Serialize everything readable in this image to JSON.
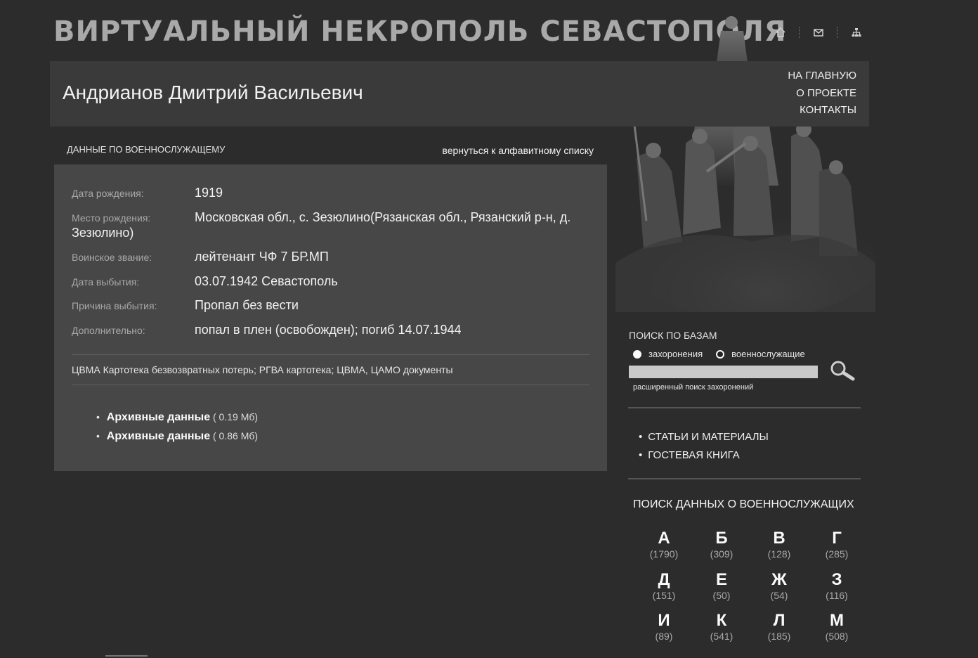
{
  "site": {
    "title": "ВИРТУАЛЬНЫЙ НЕКРОПОЛЬ СЕВАСТОПОЛЯ"
  },
  "top_icons": [
    "home-icon",
    "mail-icon",
    "sitemap-icon"
  ],
  "nav": {
    "home": "НА ГЛАВНУЮ",
    "about": "О ПРОЕКТЕ",
    "contacts": "КОНТАКТЫ"
  },
  "person": {
    "name": "Андрианов Дмитрий Васильевич",
    "section_title": "ДАННЫЕ ПО ВОЕННОСЛУЖАЩЕМУ",
    "back_link": "вернуться к алфавитному списку",
    "fields": [
      {
        "label": "Дата рождения:",
        "value": "1919"
      },
      {
        "label": "Место рождения:",
        "value": "Московская обл., с. Зезюлино(Рязанская обл., Рязанский р-н, д. Зезюлино)"
      },
      {
        "label": "Воинское звание:",
        "value": "лейтенант ЧФ 7 БР.МП"
      },
      {
        "label": "Дата выбытия:",
        "value": "03.07.1942 Севастополь"
      },
      {
        "label": "Причина выбытия:",
        "value": "Пропал без вести"
      },
      {
        "label": "Дополнительно:",
        "value": "попал в плен (освобожден); погиб 14.07.1944"
      }
    ],
    "sources": "ЦВМА Картотека безвозвратных потерь; РГВА картотека; ЦВМА, ЦАМО документы",
    "documents": [
      {
        "label": "Архивные данные",
        "size": "( 0.19 Мб)"
      },
      {
        "label": "Архивные данные",
        "size": "( 0.86 Мб)"
      }
    ]
  },
  "search": {
    "title": "ПОИСК ПО БАЗАМ",
    "radio_burials": "захоронения",
    "radio_servicemen": "военнослужащие",
    "selected": "захоронения",
    "query": "",
    "advanced_link": "расширенный поиск захоронений"
  },
  "side_menu": [
    "СТАТЬИ И МАТЕРИАЛЫ",
    "ГОСТЕВАЯ КНИГА"
  ],
  "alphabet": {
    "title": "ПОИСК ДАННЫХ О ВОЕННОСЛУЖАЩИХ",
    "items": [
      {
        "letter": "А",
        "count": "(1790)"
      },
      {
        "letter": "Б",
        "count": "(309)"
      },
      {
        "letter": "В",
        "count": "(128)"
      },
      {
        "letter": "Г",
        "count": "(285)"
      },
      {
        "letter": "Д",
        "count": "(151)"
      },
      {
        "letter": "Е",
        "count": "(50)"
      },
      {
        "letter": "Ж",
        "count": "(54)"
      },
      {
        "letter": "З",
        "count": "(116)"
      },
      {
        "letter": "И",
        "count": "(89)"
      },
      {
        "letter": "К",
        "count": "(541)"
      },
      {
        "letter": "Л",
        "count": "(185)"
      },
      {
        "letter": "М",
        "count": "(508)"
      }
    ]
  }
}
